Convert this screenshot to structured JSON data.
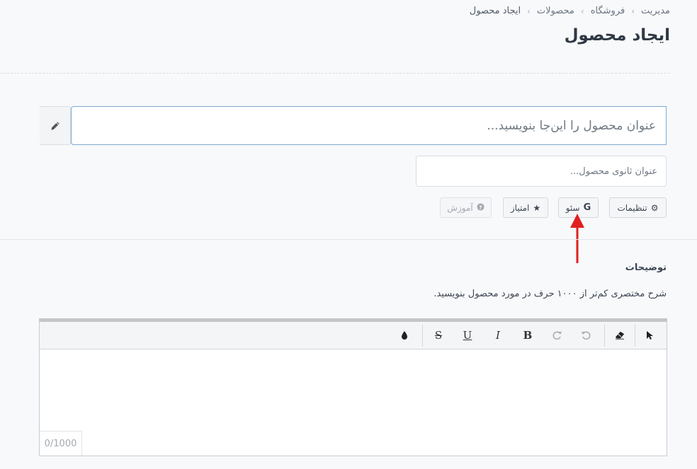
{
  "breadcrumb": [
    "مدیریت",
    "فروشگاه",
    "محصولات",
    "ایجاد محصول"
  ],
  "page_title": "ایجاد محصول",
  "product_title": {
    "placeholder": "عنوان محصول را این‌جا بنویسید...",
    "value": ""
  },
  "product_subtitle": {
    "placeholder": "عنوان ثانوی محصول...",
    "value": ""
  },
  "tabs": [
    {
      "label": "تنظیمات",
      "icon": "gear-icon",
      "state": "normal"
    },
    {
      "label": "سئو",
      "icon": "google-g-icon",
      "icon_glyph": "G",
      "state": "normal"
    },
    {
      "label": "امتیاز",
      "icon": "star-icon",
      "state": "normal"
    },
    {
      "label": "آموزش",
      "icon": "question-circle-icon",
      "state": "disabled"
    }
  ],
  "description": {
    "title": "توضیحات",
    "hint": "شرح مختصری کم‌تر از ۱۰۰۰ حرف در مورد محصول بنویسید."
  },
  "editor": {
    "toolbar": [
      "cursor-icon",
      "eraser-icon",
      "undo-icon",
      "redo-icon",
      "bold-button",
      "italic-button",
      "underline-button",
      "strikethrough-button",
      "color-drop-icon"
    ],
    "toolbar_labels": {
      "bold": "B",
      "italic": "I",
      "underline": "U",
      "strike": "S"
    },
    "counter": "0/1000"
  },
  "annotation": {
    "color": "#e02020"
  }
}
